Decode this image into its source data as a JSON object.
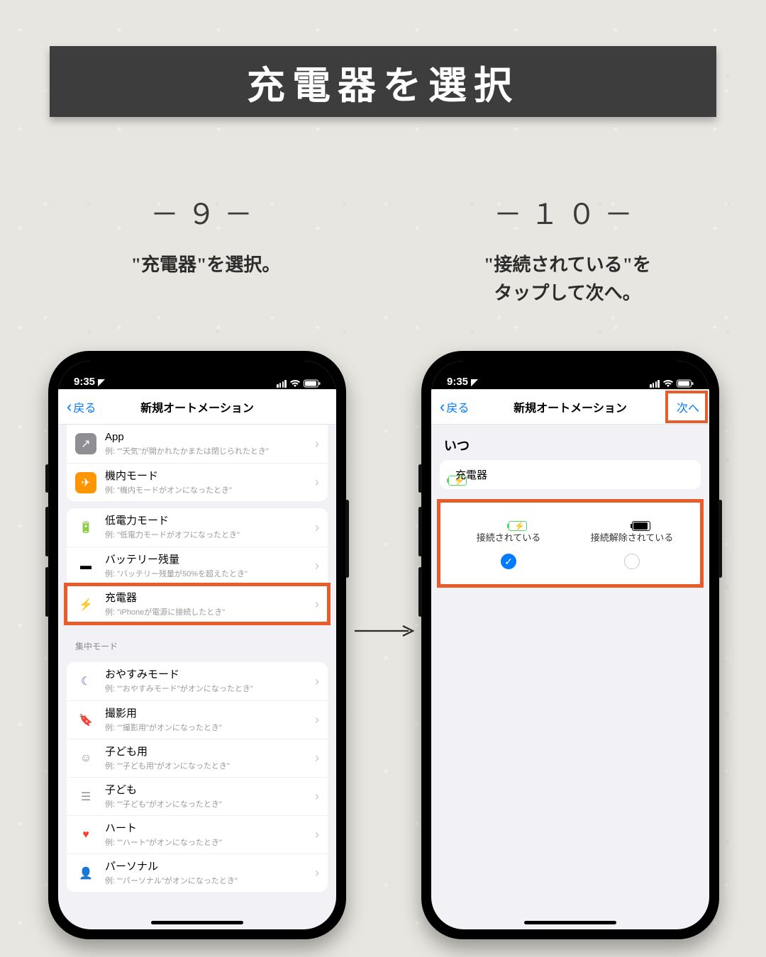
{
  "title": "充電器を選択",
  "steps": {
    "left": {
      "num": "－９－",
      "caption": "\"充電器\"を選択。"
    },
    "right": {
      "num": "－１０－",
      "caption": "\"接続されている\"を\nタップして次へ。"
    }
  },
  "status": {
    "time": "9:35",
    "location_arrow": "↗"
  },
  "nav": {
    "back": "戻る",
    "title": "新規オートメーション",
    "next": "次へ"
  },
  "left_screen": {
    "rows_a": [
      {
        "icon_bg": "#8e8e93",
        "icon_glyph": "↗",
        "icon_color": "#fff",
        "title": "App",
        "sub": "例: \"\"天気\"が開かれたかまたは閉じられたとき\""
      },
      {
        "icon_bg": "#ff9500",
        "icon_glyph": "✈",
        "icon_color": "#fff",
        "title": "機内モード",
        "sub": "例: \"機内モードがオンになったとき\""
      }
    ],
    "rows_b": [
      {
        "icon_bg": "transparent",
        "icon_glyph": "🔋",
        "icon_color": "#facc15",
        "title": "低電力モード",
        "sub": "例: \"低電力モードがオフになったとき\""
      },
      {
        "icon_bg": "transparent",
        "icon_glyph": "▬",
        "icon_color": "#000",
        "title": "バッテリー残量",
        "sub": "例: \"バッテリー残量が50%を超えたとき\""
      },
      {
        "icon_bg": "transparent",
        "icon_glyph": "⚡",
        "icon_color": "#34c759",
        "title": "充電器",
        "sub": "例: \"iPhoneが電源に接続したとき\""
      }
    ],
    "section_header": "集中モード",
    "rows_c": [
      {
        "icon_bg": "transparent",
        "icon_glyph": "☾",
        "icon_color": "#5856d6",
        "title": "おやすみモード",
        "sub": "例: \"\"おやすみモード\"がオンになったとき\""
      },
      {
        "icon_bg": "transparent",
        "icon_glyph": "🔖",
        "icon_color": "#3b4da0",
        "title": "撮影用",
        "sub": "例: \"\"撮影用\"がオンになったとき\""
      },
      {
        "icon_bg": "transparent",
        "icon_glyph": "☺",
        "icon_color": "#8e8e93",
        "title": "子ども用",
        "sub": "例: \"\"子ども用\"がオンになったとき\""
      },
      {
        "icon_bg": "transparent",
        "icon_glyph": "☰",
        "icon_color": "#8e8e93",
        "title": "子ども",
        "sub": "例: \"\"子ども\"がオンになったとき\""
      },
      {
        "icon_bg": "transparent",
        "icon_glyph": "♥",
        "icon_color": "#ff3b30",
        "title": "ハート",
        "sub": "例: \"\"ハート\"がオンになったとき\""
      },
      {
        "icon_bg": "transparent",
        "icon_glyph": "👤",
        "icon_color": "#b28bd9",
        "title": "パーソナル",
        "sub": "例: \"\"パーソナル\"がオンになったとき\""
      }
    ]
  },
  "right_screen": {
    "when_label": "いつ",
    "chip_label": "充電器",
    "choices": {
      "connected": {
        "label": "接続されている",
        "checked": true
      },
      "disconnected": {
        "label": "接続解除されている",
        "checked": false
      }
    }
  },
  "colors": {
    "highlight": "#e85b2a",
    "ios_blue": "#007aff"
  }
}
